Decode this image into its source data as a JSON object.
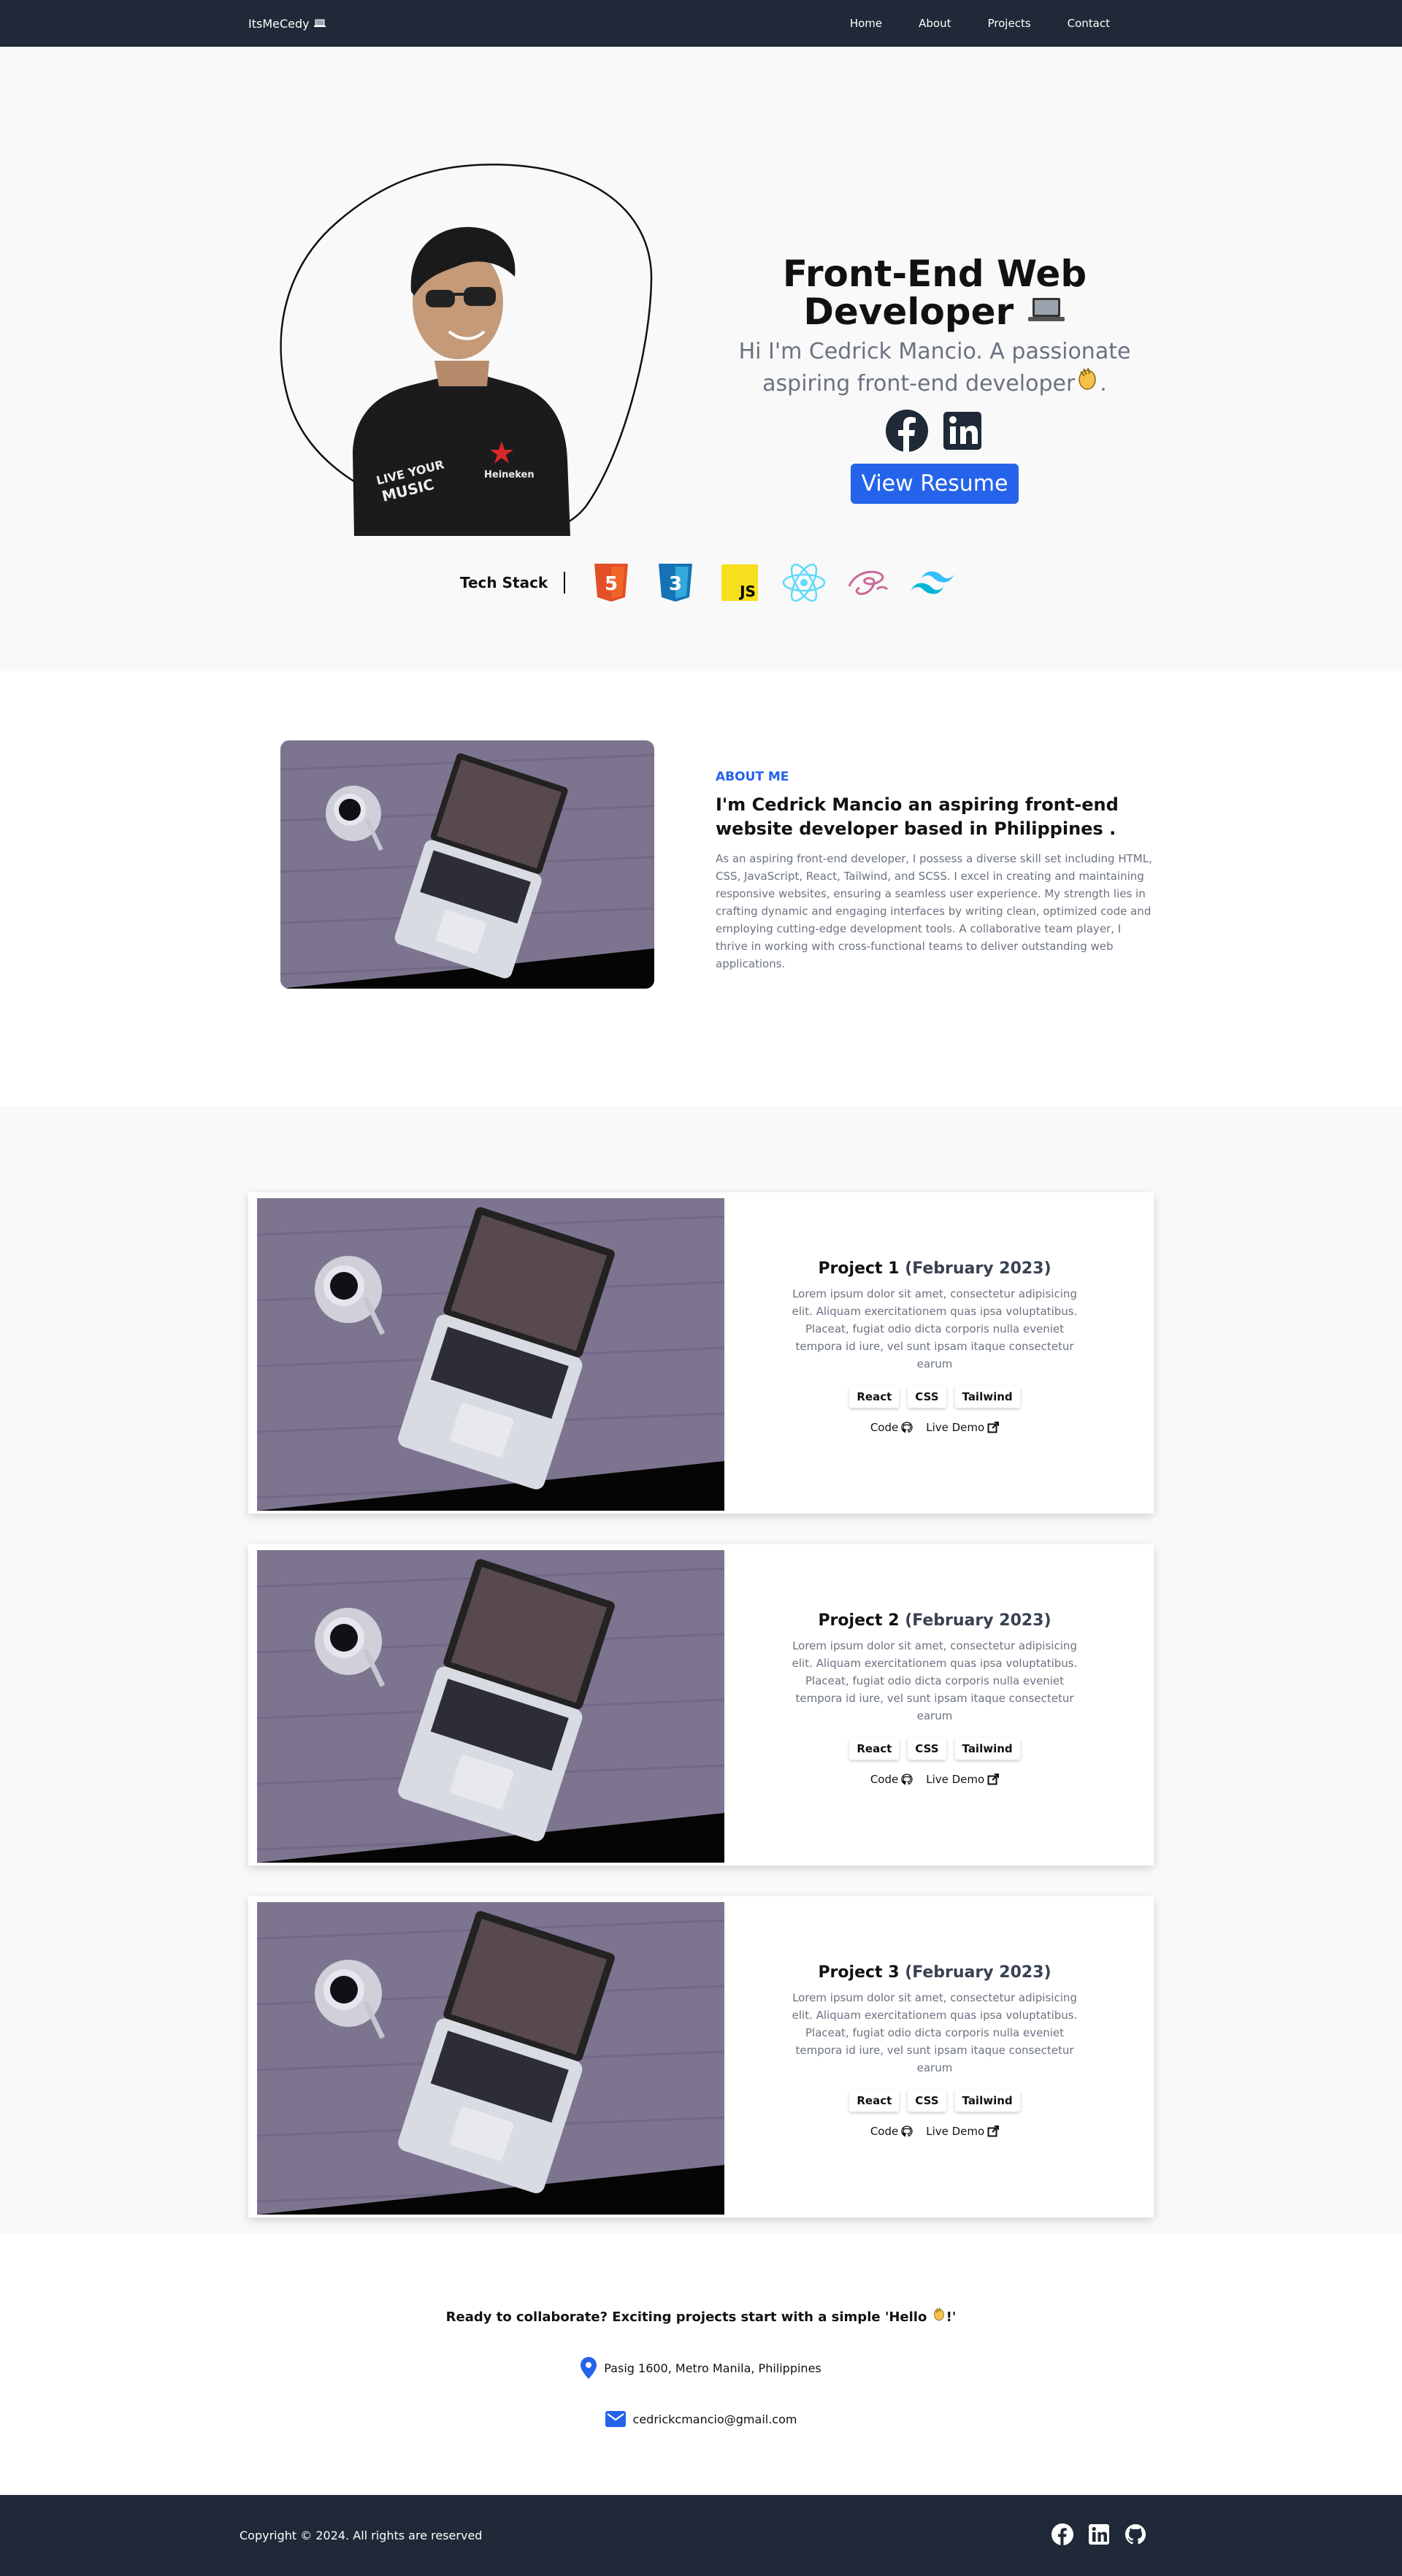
{
  "nav": {
    "brand": "ItsMeCedy",
    "brand_icon": "laptop-emoji",
    "links": [
      "Home",
      "About",
      "Projects",
      "Contact"
    ]
  },
  "hero": {
    "title_line1": "Front-End Web",
    "title_line2": "Developer",
    "subtitle": "Hi I'm Cedrick Mancio. A passionate aspiring front-end developer",
    "resume_label": "View Resume",
    "stack_label": "Tech Stack",
    "tech": [
      "html5-icon",
      "css3-icon",
      "javascript-icon",
      "react-icon",
      "sass-icon",
      "tailwind-icon"
    ],
    "socials": [
      "facebook-icon",
      "linkedin-icon"
    ]
  },
  "about": {
    "kicker": "ABOUT ME",
    "title": "I'm Cedrick Mancio an aspiring front-end website developer based in Philippines .",
    "body": "As an aspiring front-end developer, I possess a diverse skill set including HTML, CSS, JavaScript, React, Tailwind, and SCSS. I excel in creating and maintaining responsive websites, ensuring a seamless user experience. My strength lies in crafting dynamic and engaging interfaces by writing clean, optimized code and employing cutting-edge development tools. A collaborative team player, I thrive in working with cross-functional teams to deliver outstanding web applications."
  },
  "projects": [
    {
      "title": "Project 1",
      "date": "(February 2023)",
      "desc": "Lorem ipsum dolor sit amet, consectetur adipisicing elit. Aliquam exercitationem quas ipsa voluptatibus. Placeat, fugiat odio dicta corporis nulla eveniet tempora id iure, vel sunt ipsam itaque consectetur earum",
      "tags": [
        "React",
        "CSS",
        "Tailwind"
      ],
      "code_label": "Code",
      "demo_label": "Live Demo"
    },
    {
      "title": "Project 2",
      "date": "(February 2023)",
      "desc": "Lorem ipsum dolor sit amet, consectetur adipisicing elit. Aliquam exercitationem quas ipsa voluptatibus. Placeat, fugiat odio dicta corporis nulla eveniet tempora id iure, vel sunt ipsam itaque consectetur earum",
      "tags": [
        "React",
        "CSS",
        "Tailwind"
      ],
      "code_label": "Code",
      "demo_label": "Live Demo"
    },
    {
      "title": "Project 3",
      "date": "(February 2023)",
      "desc": "Lorem ipsum dolor sit amet, consectetur adipisicing elit. Aliquam exercitationem quas ipsa voluptatibus. Placeat, fugiat odio dicta corporis nulla eveniet tempora id iure, vel sunt ipsam itaque consectetur earum",
      "tags": [
        "React",
        "CSS",
        "Tailwind"
      ],
      "code_label": "Code",
      "demo_label": "Live Demo"
    }
  ],
  "contact": {
    "cta": "Ready to collaborate? Exciting projects start with a simple 'Hello",
    "cta_end": "!'",
    "location": "Pasig 1600, Metro Manila, Philippines",
    "email": "cedrickcmancio@gmail.com"
  },
  "footer": {
    "copyright": "Copyright © 2024. All rights are reserved",
    "icons": [
      "facebook-icon",
      "linkedin-icon",
      "github-icon"
    ]
  },
  "colors": {
    "nav_bg": "#1f2937",
    "accent": "#2563eb",
    "hero_bg": "#f9f9f9"
  }
}
